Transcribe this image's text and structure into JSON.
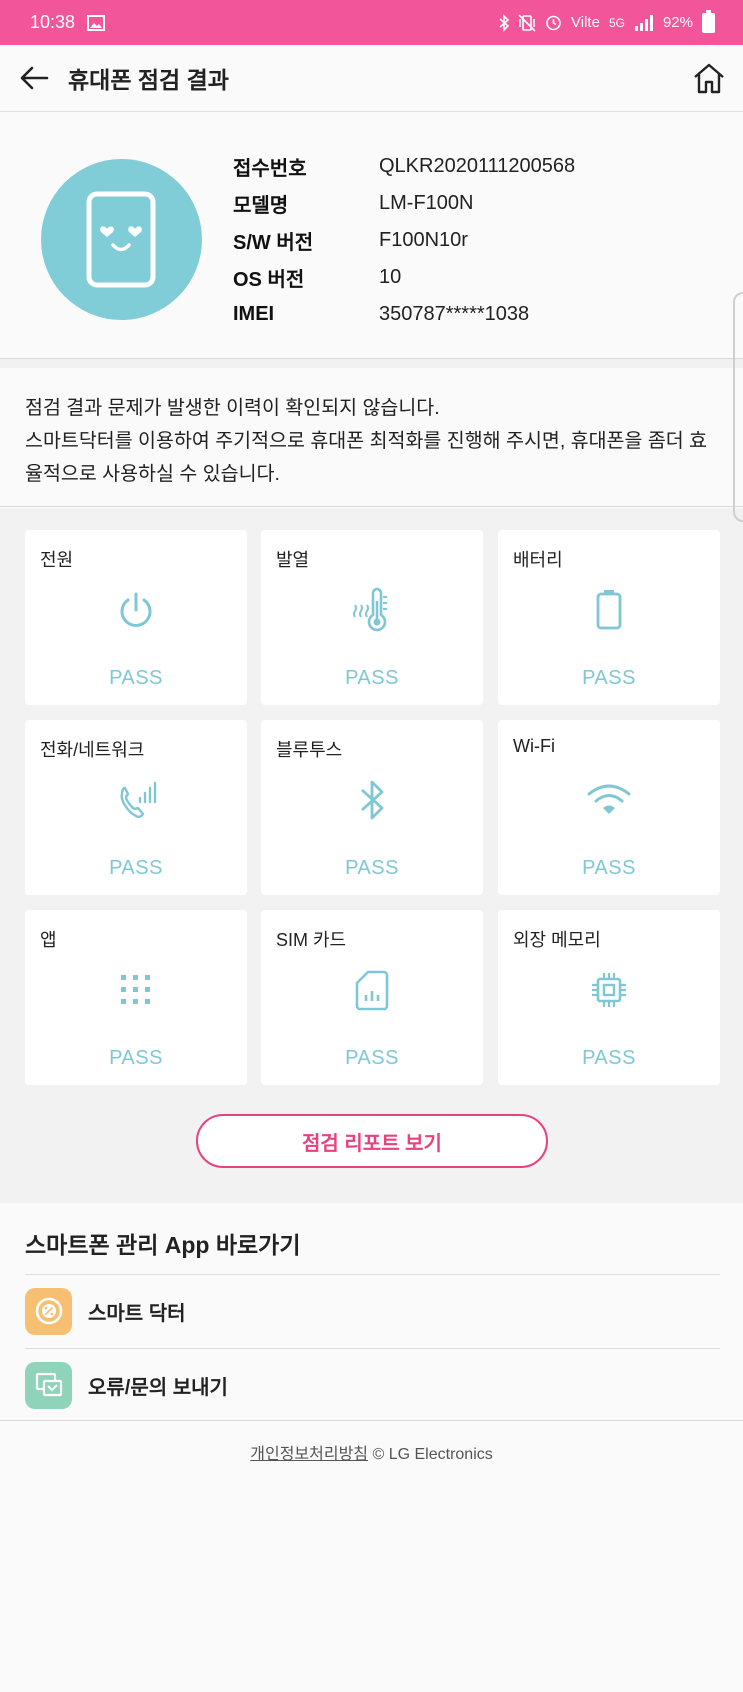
{
  "status_bar": {
    "time": "10:38",
    "network": "Vilte",
    "signal": "5G",
    "battery": "92%"
  },
  "header": {
    "title": "휴대폰 점검 결과"
  },
  "device": {
    "rows": [
      {
        "key": "접수번호",
        "value": "QLKR2020111200568"
      },
      {
        "key": "모델명",
        "value": "LM-F100N"
      },
      {
        "key": "S/W 버전",
        "value": "F100N10r"
      },
      {
        "key": "OS 버전",
        "value": "10"
      },
      {
        "key": "IMEI",
        "value": "350787*****1038"
      }
    ]
  },
  "message": {
    "line1": "점검 결과 문제가 발생한 이력이 확인되지 않습니다.",
    "line2": "스마트닥터를 이용하여 주기적으로 휴대폰 최적화를 진행해 주시면, 휴대폰을 좀더 효율적으로 사용하실 수 있습니다."
  },
  "checks": [
    {
      "label": "전원",
      "status": "PASS",
      "icon": "power-icon"
    },
    {
      "label": "발열",
      "status": "PASS",
      "icon": "thermometer-icon"
    },
    {
      "label": "배터리",
      "status": "PASS",
      "icon": "battery-icon"
    },
    {
      "label": "전화/네트워크",
      "status": "PASS",
      "icon": "phone-signal-icon"
    },
    {
      "label": "블루투스",
      "status": "PASS",
      "icon": "bluetooth-icon"
    },
    {
      "label": "Wi-Fi",
      "status": "PASS",
      "icon": "wifi-icon"
    },
    {
      "label": "앱",
      "status": "PASS",
      "icon": "apps-grid-icon"
    },
    {
      "label": "SIM 카드",
      "status": "PASS",
      "icon": "sim-card-icon"
    },
    {
      "label": "외장 메모리",
      "status": "PASS",
      "icon": "memory-chip-icon"
    }
  ],
  "report_button": {
    "label": "점검 리포트 보기"
  },
  "shortcuts": {
    "heading": "스마트폰 관리 App 바로가기",
    "items": [
      {
        "label": "스마트 닥터",
        "color": "#f7bf72",
        "icon": "smart-doctor-icon"
      },
      {
        "label": "오류/문의 보내기",
        "color": "#8fd3bb",
        "icon": "error-report-icon"
      }
    ]
  },
  "footer": {
    "privacy_link": "개인정보처리방침",
    "copyright": "© LG Electronics"
  },
  "colors": {
    "accent": "#f2559a",
    "pass": "#7fc7d4",
    "button": "#e8417f"
  }
}
